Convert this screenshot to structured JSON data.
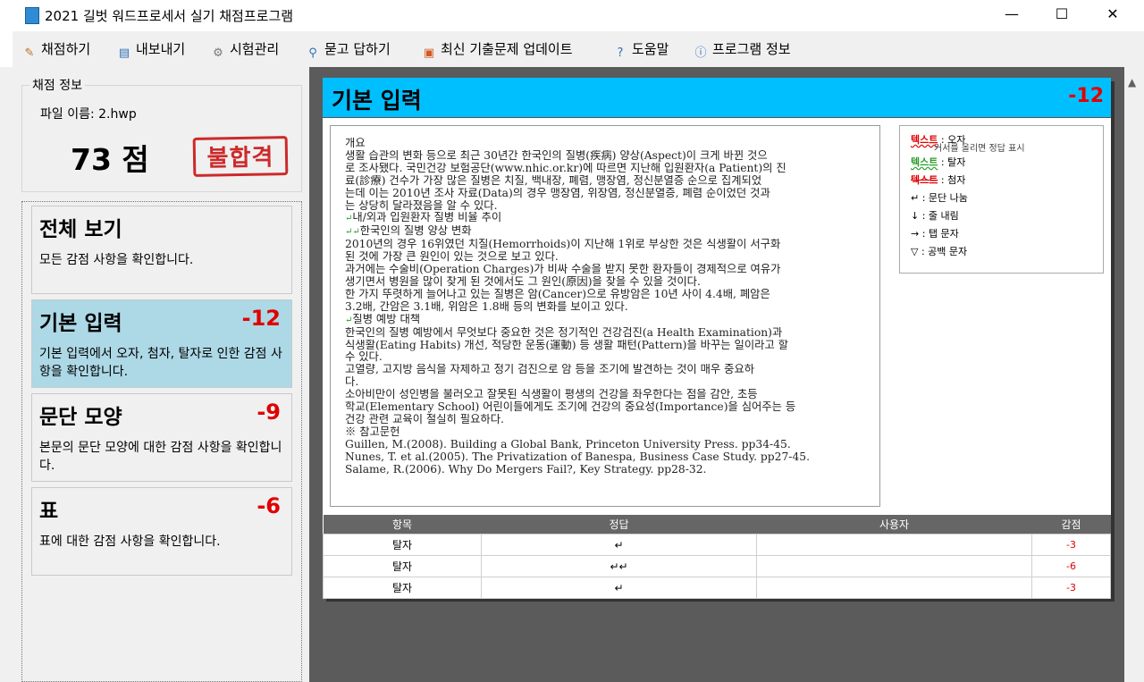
{
  "window": {
    "title": "2021 길벗 워드프로세서 실기 채점프로그램",
    "minimize": "—",
    "maximize": "☐",
    "close": "✕"
  },
  "menu": [
    {
      "label": "채점하기",
      "icon": "pencil-icon"
    },
    {
      "label": "내보내기",
      "icon": "save-icon"
    },
    {
      "label": "시험관리",
      "icon": "gear-icon"
    },
    {
      "label": "묻고 답하기",
      "icon": "qa-icon"
    },
    {
      "label": "최신 기출문제 업데이트",
      "icon": "gift-icon"
    },
    {
      "label": "도움말",
      "icon": "help-icon"
    },
    {
      "label": "프로그램 정보",
      "icon": "info-icon"
    }
  ],
  "grading": {
    "legend": "채점 정보",
    "file": "파일 이름: 2.hwp",
    "score": "73 점",
    "result": "불합격"
  },
  "categories": [
    {
      "name": "전체 보기",
      "score": "",
      "desc": "모든 감점 사항을 확인합니다."
    },
    {
      "name": "기본 입력",
      "score": "-12",
      "desc": "기본 입력에서 오자, 첨자, 탈자로 인한 감점 사항을 확인합니다."
    },
    {
      "name": "문단 모양",
      "score": "-9",
      "desc": "본문의 문단 모양에 대한 감점 사항을 확인합니다."
    },
    {
      "name": "표",
      "score": "-6",
      "desc": "표에 대한 감점 사항을 확인합니다."
    }
  ],
  "panel": {
    "title": "기본 입력",
    "score": "-12"
  },
  "document": {
    "lines": [
      "개요",
      "생활 습관의 변화 등으로 최근 30년간 한국인의 질병(疾病) 양상(Aspect)이 크게 바뀐 것으",
      "로 조사됐다. 국민건강 보험공단(www.nhic.or.kr)에 따르면 지난해 입원환자(a Patient)의 진",
      "료(診療) 건수가 가장 많은 질병은 치질, 백내장, 폐렴, 맹장염, 정신분열증 순으로 집계되었",
      "는데 이는 2010년 조사 자료(Data)의 경우 맹장염, 위장염, 정신분열증, 폐렴 순이었던 것과",
      "는 상당히 달라졌음을 알 수 있다.",
      "↵내/외과 입원환자 질병 비율 추이",
      "↵↵한국인의 질병 양상 변화",
      "2010년의 경우 16위였던 치질(Hemorrhoids)이 지난해 1위로 부상한 것은 식생활이 서구화",
      "된 것에 가장 큰 원인이 있는 것으로 보고 있다.",
      "과거에는 수술비(Operation Charges)가 비싸 수술을 받지 못한 환자들이 경제적으로 여유가",
      "생기면서 병원을 많이 찾게 된 것에서도 그 원인(原因)을 찾을 수 있을 것이다.",
      "한 가지 뚜렷하게 늘어나고 있는 질병은 암(Cancer)으로 유방암은 10년 사이 4.4배, 폐암은",
      "3.2배, 간암은 3.1배, 위암은 1.8배 등의 변화를 보이고 있다.",
      "↵질병 예방 대책",
      "한국인의 질병 예방에서 무엇보다 중요한 것은 정기적인 건강검진(a Health Examination)과",
      "식생활(Eating Habits) 개선, 적당한 운동(運動) 등 생활 패턴(Pattern)을 바꾸는 일이라고 할",
      "수 있다.",
      "고열량, 고지방 음식을 자제하고 정기 검진으로 암 등을 조기에 발견하는 것이 매우 중요하",
      "다.",
      "소아비만이 성인병을 불러오고 잘못된 식생활이 평생의 건강을 좌우한다는 점을 감안, 초등",
      "학교(Elementary School) 어린이들에게도 조기에 건강의 중요성(Importance)을 심어주는 등",
      "건강 관련 교육이 절실히 필요하다.",
      "",
      "※ 참고문헌",
      "Guillen, M.(2008). Building a Global Bank, Princeton University Press. pp34-45.",
      "Nunes, T. et al.(2005). The Privatization of Banespa, Business Case Study. pp27-45.",
      "Salame, R.(2006). Why Do Mergers Fail?, Key Strategy. pp28-32."
    ]
  },
  "legend": {
    "typo_word": "텍스트",
    "typo_label": " : 오자",
    "typo_hint": "커서를 올리면 정답 표시",
    "missing_word": "텍스트",
    "missing_label": " : 탈자",
    "extra_word": "텍스트",
    "extra_label": " : 첨자",
    "para": "↵ : 문단 나눔",
    "line": "↓ : 줄 내림",
    "tab": "→ : 탭 문자",
    "space": "▽ : 공백 문자"
  },
  "table": {
    "headers": [
      "항목",
      "정답",
      "사용자",
      "감점"
    ],
    "rows": [
      [
        "탈자",
        "↵",
        "",
        "-3"
      ],
      [
        "탈자",
        "↵↵",
        "",
        "-6"
      ],
      [
        "탈자",
        "↵",
        "",
        "-3"
      ]
    ]
  },
  "colors": {
    "accent": "#00bfff",
    "selected": "#add8e6",
    "deduction": "#e00000"
  }
}
